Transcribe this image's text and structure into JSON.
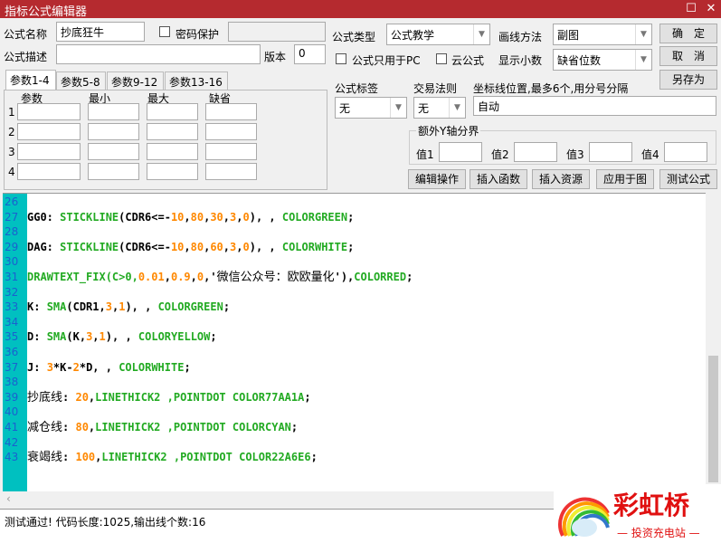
{
  "window": {
    "title": "指标公式编辑器",
    "maximize": "☐",
    "close": "✕"
  },
  "form": {
    "name_label": "公式名称",
    "name_value": "抄底狂牛",
    "password_label": "密码保护",
    "password_checked": false,
    "desc_label": "公式描述",
    "desc_value": "",
    "version_label": "版本",
    "version_value": "0",
    "type_label": "公式类型",
    "type_value": "公式教学",
    "draw_label": "画线方法",
    "draw_value": "副图",
    "pc_only_label": "公式只用于PC",
    "cloud_label": "云公式",
    "decimals_label": "显示小数",
    "decimals_value": "缺省位数",
    "tag_label": "公式标签",
    "tag_value": "无",
    "rule_label": "交易法则",
    "rule_value": "无",
    "axis_label": "坐标线位置,最多6个,用分号分隔",
    "axis_value": "自动",
    "extra_y_label": "额外Y轴分界",
    "values": [
      "值1",
      "值2",
      "值3",
      "值4"
    ]
  },
  "buttons": {
    "ok": "确　定",
    "cancel": "取　消",
    "save_as": "另存为",
    "edit": "编辑操作",
    "insert_func": "插入函数",
    "insert_res": "插入资源",
    "apply": "应用于图",
    "test": "测试公式"
  },
  "tabs": [
    "参数1-4",
    "参数5-8",
    "参数9-12",
    "参数13-16"
  ],
  "params": {
    "headers": [
      "参数",
      "最小",
      "最大",
      "缺省"
    ],
    "rows": [
      "1",
      "2",
      "3",
      "4"
    ]
  },
  "code": [
    {
      "num": "26",
      "tokens": []
    },
    {
      "num": "27",
      "tokens": [
        [
          "GG0: ",
          "b"
        ],
        [
          "STICKLINE",
          "k"
        ],
        [
          "(CDR6<=-",
          "b"
        ],
        [
          "10",
          "n"
        ],
        [
          ",",
          "b"
        ],
        [
          "80",
          "n"
        ],
        [
          ",",
          "b"
        ],
        [
          "30",
          "n"
        ],
        [
          ",",
          "b"
        ],
        [
          "3",
          "n"
        ],
        [
          ",",
          "b"
        ],
        [
          "0",
          "n"
        ],
        [
          "), , ",
          "b"
        ],
        [
          "COLORGREEN",
          "k"
        ],
        [
          ";",
          "b"
        ]
      ]
    },
    {
      "num": "28",
      "tokens": []
    },
    {
      "num": "29",
      "tokens": [
        [
          "DAG: ",
          "b"
        ],
        [
          "STICKLINE",
          "k"
        ],
        [
          "(CDR6<=-",
          "b"
        ],
        [
          "10",
          "n"
        ],
        [
          ",",
          "b"
        ],
        [
          "80",
          "n"
        ],
        [
          ",",
          "b"
        ],
        [
          "60",
          "n"
        ],
        [
          ",",
          "b"
        ],
        [
          "3",
          "n"
        ],
        [
          ",",
          "b"
        ],
        [
          "0",
          "n"
        ],
        [
          "), , ",
          "b"
        ],
        [
          "COLORWHITE",
          "k"
        ],
        [
          ";",
          "b"
        ]
      ]
    },
    {
      "num": "30",
      "tokens": []
    },
    {
      "num": "31",
      "tokens": [
        [
          "DRAWTEXT_FIX",
          "k"
        ],
        [
          "(C>0,",
          "k"
        ],
        [
          "0.01",
          "n"
        ],
        [
          ",",
          "b"
        ],
        [
          "0.9",
          "n"
        ],
        [
          ",",
          "b"
        ],
        [
          "0",
          "n"
        ],
        [
          ",'",
          "b"
        ],
        [
          "微信公众号：欧欧量化",
          "z"
        ],
        [
          "'),",
          "b"
        ],
        [
          "COLORRED",
          "k"
        ],
        [
          ";",
          "b"
        ]
      ]
    },
    {
      "num": "32",
      "tokens": []
    },
    {
      "num": "33",
      "tokens": [
        [
          "K: ",
          "b"
        ],
        [
          "SMA",
          "k"
        ],
        [
          "(CDR1,",
          "b"
        ],
        [
          "3",
          "n"
        ],
        [
          ",",
          "b"
        ],
        [
          "1",
          "n"
        ],
        [
          "), , ",
          "b"
        ],
        [
          "COLORGREEN",
          "k"
        ],
        [
          ";",
          "b"
        ]
      ]
    },
    {
      "num": "34",
      "tokens": []
    },
    {
      "num": "35",
      "tokens": [
        [
          "D: ",
          "b"
        ],
        [
          "SMA",
          "k"
        ],
        [
          "(K,",
          "b"
        ],
        [
          "3",
          "n"
        ],
        [
          ",",
          "b"
        ],
        [
          "1",
          "n"
        ],
        [
          "), , ",
          "b"
        ],
        [
          "COLORYELLOW",
          "k"
        ],
        [
          ";",
          "b"
        ]
      ]
    },
    {
      "num": "36",
      "tokens": []
    },
    {
      "num": "37",
      "tokens": [
        [
          "J: ",
          "b"
        ],
        [
          "3",
          "n"
        ],
        [
          "*K-",
          "b"
        ],
        [
          "2",
          "n"
        ],
        [
          "*D, , ",
          "b"
        ],
        [
          "COLORWHITE",
          "k"
        ],
        [
          ";",
          "b"
        ]
      ]
    },
    {
      "num": "38",
      "tokens": []
    },
    {
      "num": "39",
      "tokens": [
        [
          "抄底线",
          "z"
        ],
        [
          ": ",
          "b"
        ],
        [
          "20",
          "n"
        ],
        [
          ",",
          "b"
        ],
        [
          "LINETHICK2 ,POINTDOT COLOR77AA1A",
          "k"
        ],
        [
          ";",
          "b"
        ]
      ]
    },
    {
      "num": "40",
      "tokens": []
    },
    {
      "num": "41",
      "tokens": [
        [
          "减仓线",
          "z"
        ],
        [
          ": ",
          "b"
        ],
        [
          "80",
          "n"
        ],
        [
          ",",
          "b"
        ],
        [
          "LINETHICK2 ,POINTDOT COLORCYAN",
          "k"
        ],
        [
          ";",
          "b"
        ]
      ]
    },
    {
      "num": "42",
      "tokens": []
    },
    {
      "num": "43",
      "tokens": [
        [
          "衰竭线",
          "z"
        ],
        [
          ": ",
          "b"
        ],
        [
          "100",
          "n"
        ],
        [
          ",",
          "b"
        ],
        [
          "LINETHICK2 ,POINTDOT COLOR22A6E6",
          "k"
        ],
        [
          ";",
          "b"
        ]
      ]
    }
  ],
  "status": {
    "message": "测试通过! 代码长度:1025,输出线个数:16"
  },
  "watermark": {
    "brand": "彩虹桥",
    "slogan": "投资充电站"
  },
  "colors": {
    "titlebar": "#b52a2f",
    "gutter": "#00c0c0",
    "keyword": "#22aa22",
    "number": "#ff8800"
  }
}
